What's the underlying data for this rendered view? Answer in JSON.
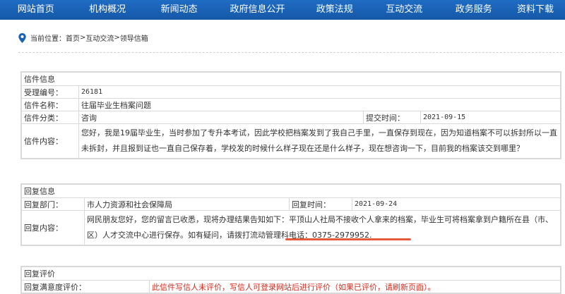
{
  "nav": {
    "items": [
      "网站首页",
      "机构概况",
      "新闻动态",
      "政府信息公开",
      "政策法规",
      "互动交流",
      "政务服务",
      "资料下载"
    ]
  },
  "breadcrumb": {
    "prefix": "当前位置：",
    "items": [
      "首页",
      ">",
      "互动交流",
      ">",
      "领导信箱"
    ]
  },
  "letter": {
    "section_title": "信件信息",
    "id_label": "受理编号：",
    "id_value": "26181",
    "name_label": "信件名称：",
    "name_value": "往届毕业生档案问题",
    "category_label": "信件分类：",
    "category_value": "咨询",
    "submit_label": "提交时间：",
    "submit_value": "2021-09-15",
    "content_label": "信件内容：",
    "content_value": "您好，我是19届毕业生，当时参加了专升本考试，因此学校把档案发到了我自己手里，一直保存到现在，因为知道档案不可以拆封所以一直未拆封，并且报到证也一直自己保存着，学校发的时候什么样子现在还是什么样子，现在想咨询一下，目前我的档案该交到哪里？"
  },
  "reply": {
    "section_title": "回复信息",
    "dept_label": "回复部门：",
    "dept_value": "市人力资源和社会保障局",
    "time_label": "回复时间：",
    "time_value": "2021-09-24",
    "content_label": "回复内容：",
    "content_value": "网民朋友您好，您的留言已收悉，现将办理结果告知如下：平顶山人社局不接收个人拿来的档案，毕业生可将档案拿到户籍所在县（市、区）人才交流中心进行保存。如有疑问，请拨打流动管理科电话：0375-2979952."
  },
  "evaluation": {
    "section_title": "回复评价",
    "satisfaction_label": "回复满意度评价：",
    "satisfaction_value": "此信件写信人未评价，写信人可登录网站后进行评价（如果已评价，请刷新页面）。"
  },
  "colors": {
    "nav": "#1a63b8",
    "highlight_underline": "#e45a3a",
    "notice": "#d42a1c"
  },
  "icons": {
    "breadcrumb": "location-pin-icon"
  }
}
